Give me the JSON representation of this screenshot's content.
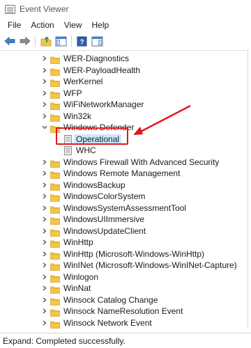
{
  "window": {
    "title": "Event Viewer"
  },
  "menu": [
    "File",
    "Action",
    "View",
    "Help"
  ],
  "toolbar": [
    "back-icon",
    "forward-icon",
    "folder-up-icon",
    "show-hide-tree-icon",
    "help-icon",
    "action-pane-icon"
  ],
  "tree": [
    {
      "label": "WER-Diagnostics",
      "type": "folder",
      "expanded": false
    },
    {
      "label": "WER-PayloadHealth",
      "type": "folder",
      "expanded": false
    },
    {
      "label": "WerKernel",
      "type": "folder",
      "expanded": false
    },
    {
      "label": "WFP",
      "type": "folder",
      "expanded": false
    },
    {
      "label": "WiFiNetworkManager",
      "type": "folder",
      "expanded": false
    },
    {
      "label": "Win32k",
      "type": "folder",
      "expanded": false
    },
    {
      "label": "Windows Defender",
      "type": "folder",
      "expanded": true
    },
    {
      "label": "Operational",
      "type": "log",
      "selected": true
    },
    {
      "label": "WHC",
      "type": "log"
    },
    {
      "label": "Windows Firewall With Advanced Security",
      "type": "folder",
      "expanded": false
    },
    {
      "label": "Windows Remote Management",
      "type": "folder",
      "expanded": false
    },
    {
      "label": "WindowsBackup",
      "type": "folder",
      "expanded": false
    },
    {
      "label": "WindowsColorSystem",
      "type": "folder",
      "expanded": false
    },
    {
      "label": "WindowsSystemAssessmentTool",
      "type": "folder",
      "expanded": false
    },
    {
      "label": "WindowsUIImmersive",
      "type": "folder",
      "expanded": false
    },
    {
      "label": "WindowsUpdateClient",
      "type": "folder",
      "expanded": false
    },
    {
      "label": "WinHttp",
      "type": "folder",
      "expanded": false
    },
    {
      "label": "WinHttp (Microsoft-Windows-WinHttp)",
      "type": "folder",
      "expanded": false
    },
    {
      "label": "WinINet (Microsoft-Windows-WinINet-Capture)",
      "type": "folder",
      "expanded": false
    },
    {
      "label": "Winlogon",
      "type": "folder",
      "expanded": false
    },
    {
      "label": "WinNat",
      "type": "folder",
      "expanded": false
    },
    {
      "label": "Winsock Catalog Change",
      "type": "folder",
      "expanded": false
    },
    {
      "label": "Winsock NameResolution Event",
      "type": "folder",
      "expanded": false
    },
    {
      "label": "Winsock Network Event",
      "type": "folder",
      "expanded": false
    }
  ],
  "status": {
    "text": "Expand:  Completed successfully."
  },
  "colors": {
    "annotation": "#e3141b",
    "folder": "#f2c54b",
    "folder_dark": "#d9a521",
    "selected": "#cce8ff"
  }
}
